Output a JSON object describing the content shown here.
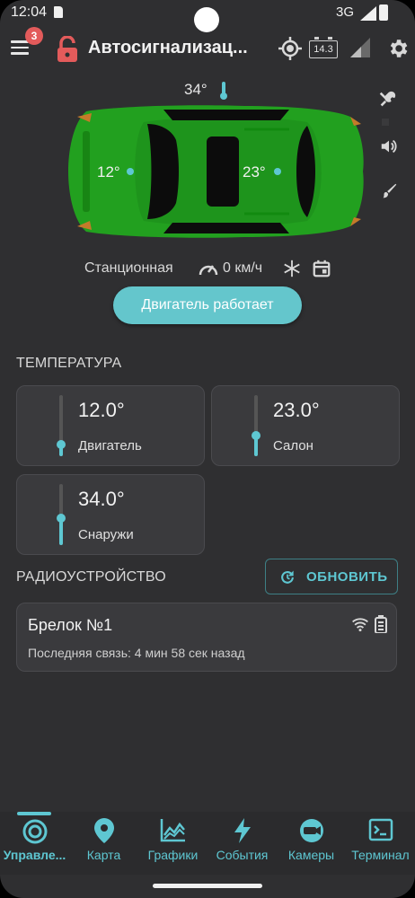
{
  "status_bar": {
    "time": "12:04",
    "network": "3G"
  },
  "app_bar": {
    "notification_count": "3",
    "title": "Автосигнализац...",
    "voltage": "14.3",
    "icons": [
      "menu-icon",
      "unlocked-lock-icon",
      "gps-icon",
      "battery-voltage-icon",
      "gsm-signal-icon",
      "settings-icon"
    ]
  },
  "car": {
    "outside_temp": "34°",
    "engine_temp": "12°",
    "cabin_temp": "23°",
    "body_color": "#22a01f",
    "side_icons": [
      "tools-icon",
      "speaker-icon",
      "brush-icon"
    ]
  },
  "state": {
    "mode": "Станционная",
    "speed": "0 км/ч",
    "engine_button": "Двигатель работает",
    "accent": "#5ec7d2"
  },
  "temperature": {
    "section_title": "ТЕМПЕРАТУРА",
    "cards": [
      {
        "value": "12.0°",
        "name": "Двигатель",
        "level": 0.2
      },
      {
        "value": "23.0°",
        "name": "Салон",
        "level": 0.35
      },
      {
        "value": "34.0°",
        "name": "Снаружи",
        "level": 0.45
      }
    ]
  },
  "radio": {
    "section_title": "РАДИОУСТРОЙСТВО",
    "refresh_label": "ОБНОВИТЬ",
    "device_name": "Брелок №1",
    "last_seen": "Последняя связь: 4 мин 58 сек назад"
  },
  "nav": {
    "items": [
      {
        "label": "Управле...",
        "icon": "control-icon",
        "active": true
      },
      {
        "label": "Карта",
        "icon": "map-pin-icon",
        "active": false
      },
      {
        "label": "Графики",
        "icon": "chart-icon",
        "active": false
      },
      {
        "label": "События",
        "icon": "lightning-icon",
        "active": false
      },
      {
        "label": "Камеры",
        "icon": "camera-icon",
        "active": false
      },
      {
        "label": "Терминал",
        "icon": "terminal-icon",
        "active": false
      }
    ]
  }
}
